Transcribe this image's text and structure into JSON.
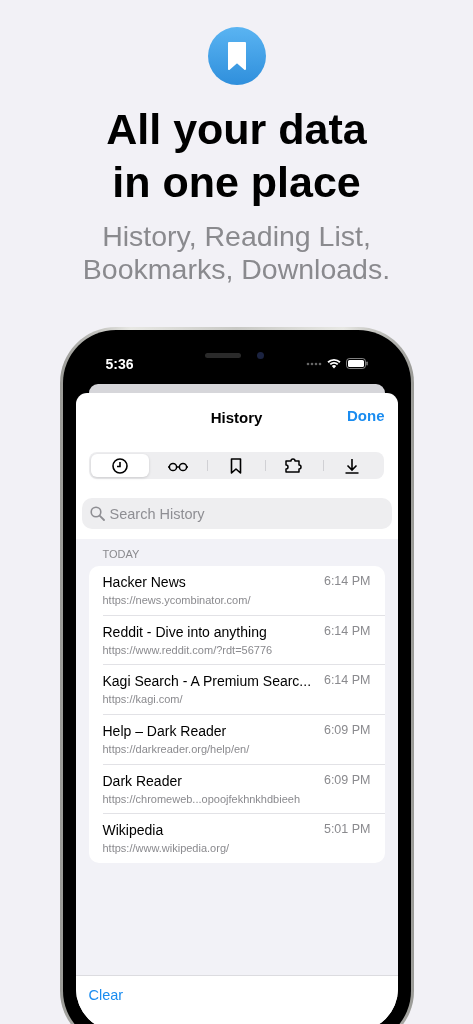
{
  "headline": "All your data in one place",
  "subtitle": "History, Reading List, Bookmarks, Downloads.",
  "phone": {
    "status_bar": {
      "time": "5:36"
    },
    "sheet": {
      "title": "History",
      "done": "Done",
      "segments": [
        {
          "kind": "clock",
          "selected": true
        },
        {
          "kind": "glasses",
          "selected": false
        },
        {
          "kind": "bookmark",
          "selected": false
        },
        {
          "kind": "puzzle",
          "selected": false
        },
        {
          "kind": "download",
          "selected": false
        }
      ],
      "search": {
        "placeholder": "Search History"
      },
      "section": "TODAY",
      "rows": [
        {
          "title": "Hacker News",
          "url": "https://news.ycombinator.com/",
          "time": "6:14 PM"
        },
        {
          "title": "Reddit - Dive into anything",
          "url": "https://www.reddit.com/?rdt=56776",
          "time": "6:14 PM"
        },
        {
          "title": "Kagi Search - A Premium Searc...",
          "url": "https://kagi.com/",
          "time": "6:14 PM"
        },
        {
          "title": "Help – Dark Reader",
          "url": "https://darkreader.org/help/en/",
          "time": "6:09 PM"
        },
        {
          "title": "Dark Reader",
          "url": "https://chromeweb...opoojfekhnkhdbieeh",
          "time": "6:09 PM"
        },
        {
          "title": "Wikipedia",
          "url": "https://www.wikipedia.org/",
          "time": "5:01 PM"
        }
      ],
      "toolbar": {
        "clear": "Clear"
      }
    }
  }
}
